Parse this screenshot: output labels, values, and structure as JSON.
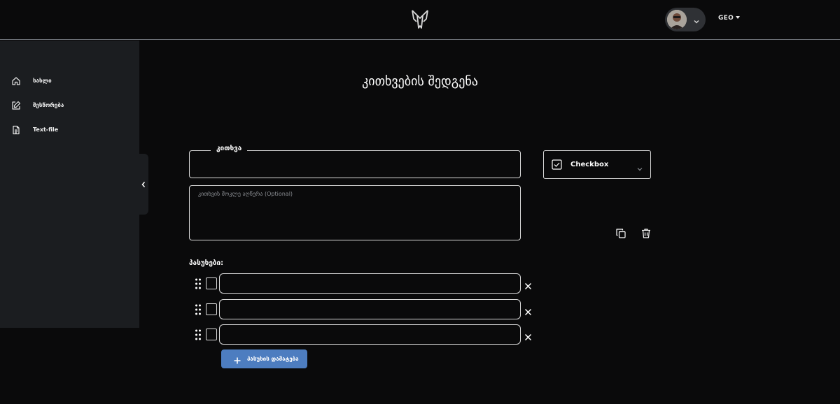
{
  "header": {
    "logo_icon": "winged-logo-icon",
    "user_menu_icon": "chevron-down-icon",
    "language": "GEO"
  },
  "sidebar": {
    "items": [
      {
        "icon": "home-icon",
        "label": "სახლი"
      },
      {
        "icon": "edit-icon",
        "label": "შესწორება"
      },
      {
        "icon": "file-text-icon",
        "label": "Text-file"
      }
    ],
    "collapse_icon": "chevron-left-icon"
  },
  "main": {
    "title": "კითხვების შედგენა",
    "question": {
      "legend": "კითხვა",
      "value": ""
    },
    "description": {
      "placeholder": "კითხვის მოკლე აღწერა (Optional)"
    },
    "question_type": {
      "icon": "checkbox-checked-icon",
      "label": "Checkbox"
    },
    "actions": [
      {
        "icon": "copy-icon"
      },
      {
        "icon": "trash-icon"
      }
    ],
    "answers_title": "პასუხები:",
    "answers": [
      {
        "value": "",
        "checked": false
      },
      {
        "value": "",
        "checked": false
      },
      {
        "value": "",
        "checked": false
      }
    ],
    "add_answer_label": "პასუხის დამატება"
  },
  "colors": {
    "background": "#0a0a0b",
    "sidebar": "#1b1d20",
    "accent": "#4d7dc0",
    "border": "#d9d9d9"
  }
}
